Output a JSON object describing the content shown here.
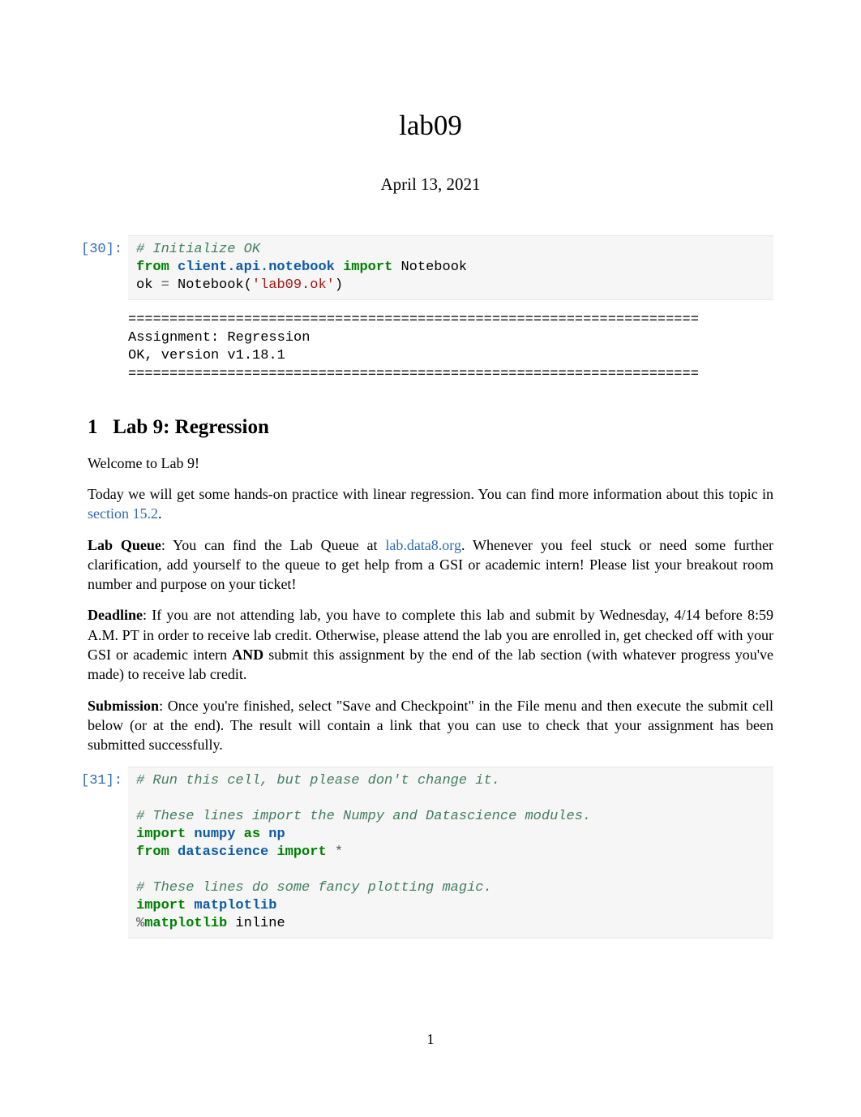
{
  "title": "lab09",
  "date": "April 13, 2021",
  "cells": {
    "cell1": {
      "label": "[30]:",
      "comment1": "# Initialize OK",
      "kw_from": "from",
      "mod1": "client.api.notebook",
      "kw_import": "import",
      "name1": "Notebook",
      "assign_lhs": "ok",
      "equals": " = ",
      "func": "Notebook(",
      "string1": "'lab09.ok'",
      "close": ")"
    },
    "output1": {
      "sep1": "=====================================================================",
      "line1": "Assignment: Regression",
      "line2": "OK, version v1.18.1",
      "sep2": "====================================================================="
    }
  },
  "section": {
    "number": "1",
    "title": "Lab 9: Regression"
  },
  "paragraphs": {
    "p1": "Welcome to Lab 9!",
    "p2a": "Today we will get some hands-on practice with linear regression. You can find more information about this topic in ",
    "p2link": "section 15.2",
    "p2b": ".",
    "p3label": "Lab Queue",
    "p3a": ": You can find the Lab Queue at ",
    "p3link": "lab.data8.org",
    "p3b": ". Whenever you feel stuck or need some further clarification, add yourself to the queue to get help from a GSI or academic intern! Please list your breakout room number and purpose on your ticket!",
    "p4label": "Deadline",
    "p4a": ": If you are not attending lab, you have to complete this lab and submit by Wednesday, 4/14 before 8:59 A.M. PT in order to receive lab credit. Otherwise, please attend the lab you are enrolled in, get checked off with your GSI or academic intern ",
    "p4and": "AND",
    "p4b": " submit this assignment by the end of the lab section (with whatever progress you've made) to receive lab credit.",
    "p5label": "Submission",
    "p5a": ": Once you're finished, select \"Save and Checkpoint\" in the File menu and then execute the submit cell below (or at the end). The result will contain a link that you can use to check that your assignment has been submitted successfully."
  },
  "cell2": {
    "label": "[31]:",
    "comment1": "# Run this cell, but please don't change it.",
    "comment2": "# These lines import the Numpy and Datascience modules.",
    "kw_import": "import",
    "mod_numpy": "numpy",
    "kw_as": "as",
    "mod_np": "np",
    "kw_from": "from",
    "mod_ds": "datascience",
    "kw_import2": "import",
    "star": "*",
    "comment3": "# These lines do some fancy plotting magic.",
    "kw_import3": "import",
    "mod_mpl": "matplotlib",
    "magic_pct": "%",
    "magic_cmd": "matplotlib",
    "magic_arg": " inline"
  },
  "page_number": "1"
}
